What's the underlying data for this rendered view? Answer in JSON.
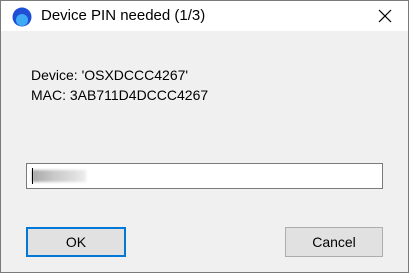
{
  "window": {
    "title": "Device PIN needed (1/3)",
    "app_icon": "blue-circle-app-icon",
    "close_icon": "close-icon"
  },
  "device": {
    "name_line": "Device: 'OSXDCCC4267'",
    "mac_line": "MAC: 3AB711D4DCCC4267"
  },
  "pin_input": {
    "value": ""
  },
  "buttons": {
    "ok_label": "OK",
    "cancel_label": "Cancel"
  },
  "colors": {
    "accent": "#0078d7",
    "dialog_bg": "#f0f0f0",
    "titlebar_bg": "#ffffff",
    "button_bg": "#e1e1e1"
  }
}
